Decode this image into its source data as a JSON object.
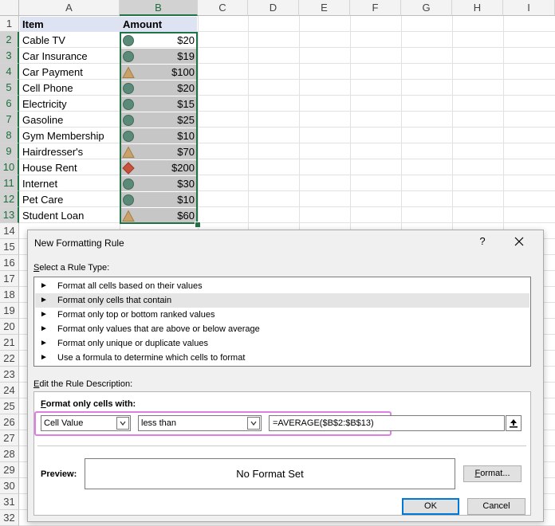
{
  "sheet": {
    "columns": [
      "A",
      "B",
      "C",
      "D",
      "E",
      "F",
      "G",
      "H",
      "I"
    ],
    "rows": [
      "1",
      "2",
      "3",
      "4",
      "5",
      "6",
      "7",
      "8",
      "9",
      "10",
      "11",
      "12",
      "13",
      "14",
      "15",
      "16",
      "17",
      "18",
      "19",
      "20",
      "21",
      "22",
      "23",
      "24",
      "25",
      "26",
      "27",
      "28",
      "29",
      "30",
      "31",
      "32"
    ],
    "header": {
      "item": "Item",
      "amount": "Amount"
    },
    "data": [
      {
        "item": "Cable TV",
        "amount": "$20",
        "icon": "circle"
      },
      {
        "item": "Car Insurance",
        "amount": "$19",
        "icon": "circle"
      },
      {
        "item": "Car Payment",
        "amount": "$100",
        "icon": "triangle"
      },
      {
        "item": "Cell Phone",
        "amount": "$20",
        "icon": "circle"
      },
      {
        "item": "Electricity",
        "amount": "$15",
        "icon": "circle"
      },
      {
        "item": "Gasoline",
        "amount": "$25",
        "icon": "circle"
      },
      {
        "item": "Gym Membership",
        "amount": "$10",
        "icon": "circle"
      },
      {
        "item": "Hairdresser's",
        "amount": "$70",
        "icon": "triangle"
      },
      {
        "item": "House Rent",
        "amount": "$200",
        "icon": "diamond"
      },
      {
        "item": "Internet",
        "amount": "$30",
        "icon": "circle"
      },
      {
        "item": "Pet Care",
        "amount": "$10",
        "icon": "circle"
      },
      {
        "item": "Student Loan",
        "amount": "$60",
        "icon": "triangle"
      }
    ],
    "colors": {
      "circle": "#5b8a78",
      "triangle": "#c9a26b",
      "diamond": "#c8523a",
      "accent": "#217346",
      "shade": "#c6c6c6",
      "header_fill": "#dde3f2"
    }
  },
  "dialog": {
    "title": "New Formatting Rule",
    "help": "?",
    "select_label_u": "S",
    "select_label_rest": "elect a Rule Type:",
    "rule_types": [
      "Format all cells based on their values",
      "Format only cells that contain",
      "Format only top or bottom ranked values",
      "Format only values that are above or below average",
      "Format only unique or duplicate values",
      "Use a formula to determine which cells to format"
    ],
    "selected_rule_index": 1,
    "edit_label_u": "E",
    "edit_label_rest": "dit the Rule Description:",
    "format_only_u": "F",
    "format_only_rest": "ormat only cells with:",
    "condition_type": "Cell Value",
    "operator": "less than",
    "formula": "=AVERAGE($B$2:$B$13)",
    "preview_label": "Preview:",
    "preview_text": "No Format Set",
    "format_button_u": "F",
    "format_button_rest": "ormat...",
    "ok_label": "OK",
    "cancel_label": "Cancel"
  }
}
